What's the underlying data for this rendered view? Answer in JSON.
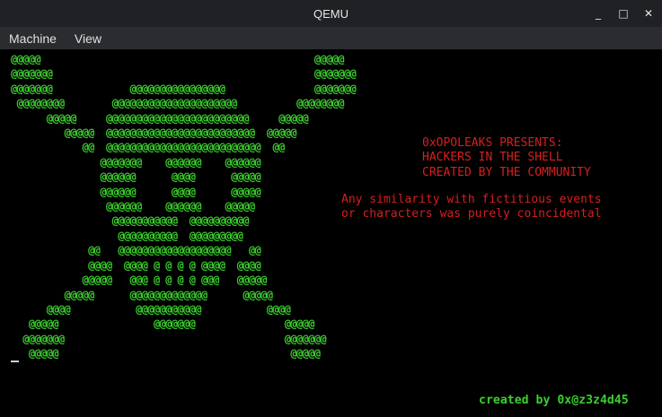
{
  "window": {
    "title": "QEMU",
    "controls": [
      "_",
      "□",
      "✕"
    ]
  },
  "menu": {
    "items": [
      "Machine",
      "View"
    ]
  },
  "screen": {
    "ascii_art": "@@@@@                                              @@@@@\n@@@@@@@                                            @@@@@@@\n@@@@@@@             @@@@@@@@@@@@@@@@               @@@@@@@\n @@@@@@@@        @@@@@@@@@@@@@@@@@@@@@          @@@@@@@@\n      @@@@@     @@@@@@@@@@@@@@@@@@@@@@@@     @@@@@\n         @@@@@  @@@@@@@@@@@@@@@@@@@@@@@@@  @@@@@\n            @@  @@@@@@@@@@@@@@@@@@@@@@@@@@  @@\n               @@@@@@@    @@@@@@    @@@@@@\n               @@@@@@      @@@@      @@@@@\n               @@@@@@      @@@@      @@@@@\n                @@@@@@    @@@@@@    @@@@@\n                 @@@@@@@@@@@  @@@@@@@@@@\n                  @@@@@@@@@@  @@@@@@@@@\n             @@   @@@@@@@@@@@@@@@@@@@   @@\n             @@@@  @@@@ @ @ @ @ @@@@  @@@@\n            @@@@@   @@@ @ @ @ @ @@@   @@@@@\n         @@@@@      @@@@@@@@@@@@@      @@@@@\n      @@@@           @@@@@@@@@@@           @@@@\n   @@@@@                @@@@@@@               @@@@@\n  @@@@@@@                                     @@@@@@@\n   @@@@@                                       @@@@@",
    "presents_lines": "0xOPOLEAKS PRESENTS:\nHACKERS IN THE SHELL\nCREATED BY THE COMMUNITY",
    "disclaimer_lines": "Any similarity with fictitious events\nor characters was purely coincidental",
    "credit": "created by 0x@z3z4d45"
  },
  "colors": {
    "ascii_green": "#3ccf2f",
    "message_red": "#d81f1f",
    "background": "#000000"
  }
}
